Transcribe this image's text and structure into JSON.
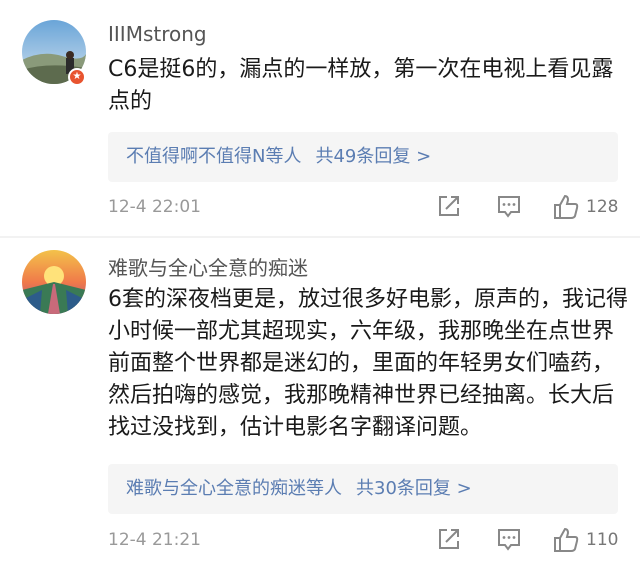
{
  "comments": [
    {
      "username": "IIIMstrong",
      "text": "C6是挺6的，漏点的一样放，第一次在电视上看见露点的",
      "reply_names": "不值得啊不值得N等人",
      "reply_count": "共49条回复 >",
      "time": "12-4 22:01",
      "likes": "128",
      "badge_icon": "verified-badge-icon"
    },
    {
      "username": "难歌与全心全意的痴迷",
      "text": "6套的深夜档更是，放过很多好电影，原声的，我记得小时候一部尤其超现实，六年级，我那晚坐在点世界前面整个世界都是迷幻的，里面的年轻男女们嗑药，然后拍嗨的感觉，我那晚精神世界已经抽离。长大后找过没找到，估计电影名字翻译问题。",
      "reply_names": "难歌与全心全意的痴迷等人",
      "reply_count": "共30条回复 >",
      "time": "12-4 21:21",
      "likes": "110"
    }
  ],
  "colors": {
    "link": "#5b7db2",
    "meta": "#999999",
    "reply_bg": "#f5f5f5"
  }
}
